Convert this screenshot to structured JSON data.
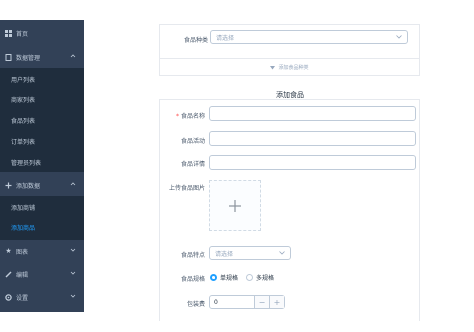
{
  "sidebar": {
    "items": [
      {
        "label": "首页",
        "icon": "grid-icon"
      },
      {
        "label": "数据管理",
        "icon": "document-icon"
      },
      {
        "label": "添加数据",
        "icon": "plus-icon"
      },
      {
        "label": "图表",
        "icon": "star-icon"
      },
      {
        "label": "编辑",
        "icon": "edit-icon"
      },
      {
        "label": "设置",
        "icon": "gear-icon"
      }
    ],
    "data_sub": [
      "用户列表",
      "商家列表",
      "食品列表",
      "订单列表",
      "管理员列表"
    ],
    "add_sub": [
      "添加商铺",
      "添加商品"
    ]
  },
  "top_panel": {
    "category_label": "食品种类",
    "category_placeholder": "请选择",
    "toggle_text": "添加食品种类"
  },
  "form": {
    "title": "添加食品",
    "name_label": "食品名称",
    "activity_label": "食品活动",
    "detail_label": "食品详情",
    "upload_label": "上传食品图片",
    "feature_label": "食品特点",
    "feature_placeholder": "请选择",
    "spec_label": "食品规格",
    "spec_options": [
      "单规格",
      "多规格"
    ],
    "packing_label": "包装费",
    "packing_value": "0"
  },
  "colors": {
    "sidebar_bg": "#324157",
    "submenu_bg": "#1f2d3d",
    "accent": "#20a0ff",
    "required": "#ff4949"
  }
}
